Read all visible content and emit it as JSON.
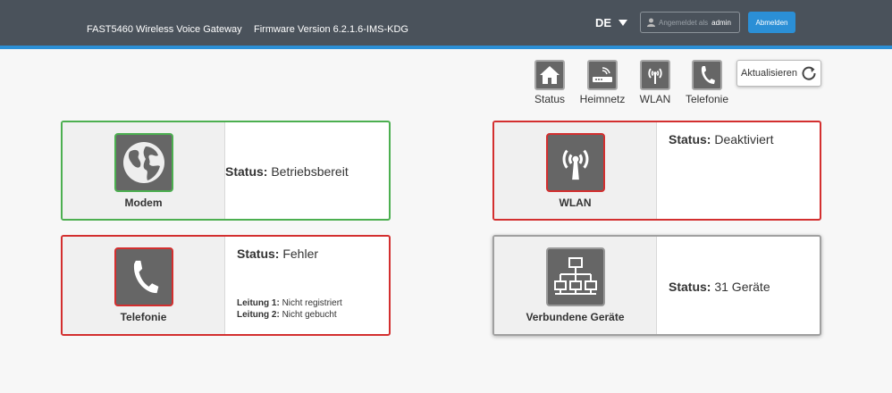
{
  "header": {
    "device": "FAST5460 Wireless Voice Gateway",
    "firmware": "Firmware Version 6.2.1.6-IMS-KDG",
    "language": "DE",
    "logged_in_label": "Angemeldet als",
    "username": "admin",
    "logout_label": "Abmelden"
  },
  "nav": {
    "items": [
      {
        "label": "Status",
        "icon": "home-icon"
      },
      {
        "label": "Heimnetz",
        "icon": "router-icon"
      },
      {
        "label": "WLAN",
        "icon": "antenna-icon"
      },
      {
        "label": "Telefonie",
        "icon": "phone-icon"
      }
    ],
    "refresh_label": "Aktualisieren"
  },
  "cards": {
    "modem": {
      "title": "Modem",
      "status_label": "Status:",
      "status_value": "Betriebsbereit",
      "state_color": "#4caf50"
    },
    "wlan": {
      "title": "WLAN",
      "status_label": "Status:",
      "status_value": "Deaktiviert",
      "state_color": "#d32f2f"
    },
    "telefonie": {
      "title": "Telefonie",
      "status_label": "Status:",
      "status_value": "Fehler",
      "state_color": "#d32f2f",
      "line1_label": "Leitung 1:",
      "line1_value": "Nicht registriert",
      "line2_label": "Leitung 2:",
      "line2_value": "Nicht gebucht"
    },
    "devices": {
      "title": "Verbundene Geräte",
      "status_label": "Status:",
      "status_value": "31 Geräte"
    }
  },
  "colors": {
    "header_bg": "#4a525b",
    "accent": "#2b8fd6"
  }
}
